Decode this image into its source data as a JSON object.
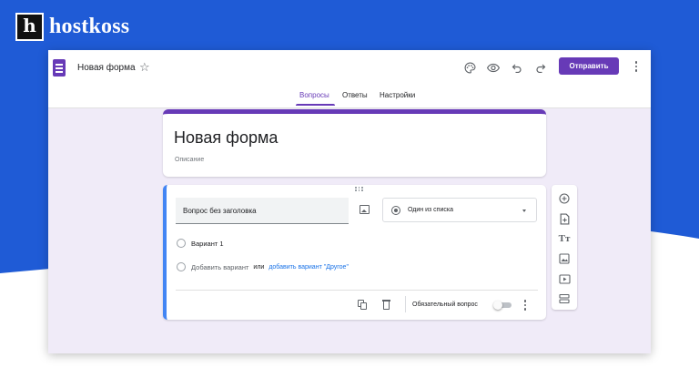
{
  "brand": {
    "logo_letter": "h",
    "name": "hostkoss"
  },
  "colors": {
    "banner_blue": "#1f5bd6",
    "accent_purple": "#673ab7",
    "question_accent": "#4285f4"
  },
  "app": {
    "doc_title": "Новая форма",
    "send_label": "Отправить",
    "toolbar_icons": [
      "palette-icon",
      "preview-eye-icon",
      "undo-icon",
      "redo-icon",
      "more-vert-icon"
    ],
    "tabs": [
      {
        "label": "Вопросы",
        "active": true
      },
      {
        "label": "Ответы",
        "active": false
      },
      {
        "label": "Настройки",
        "active": false
      }
    ]
  },
  "form": {
    "title": "Новая форма",
    "description_placeholder": "Описание"
  },
  "question": {
    "title_placeholder": "Вопрос без заголовка",
    "type": "Один из списка",
    "options": [
      "Вариант 1"
    ],
    "add_option": "Добавить вариант",
    "or": "или",
    "add_other": "добавить вариант \"Другое\"",
    "required_label": "Обязательный вопрос",
    "required": false
  },
  "side_toolbar": [
    "add-question-icon",
    "import-questions-icon",
    "add-title-icon",
    "add-image-icon",
    "add-video-icon",
    "add-section-icon"
  ]
}
